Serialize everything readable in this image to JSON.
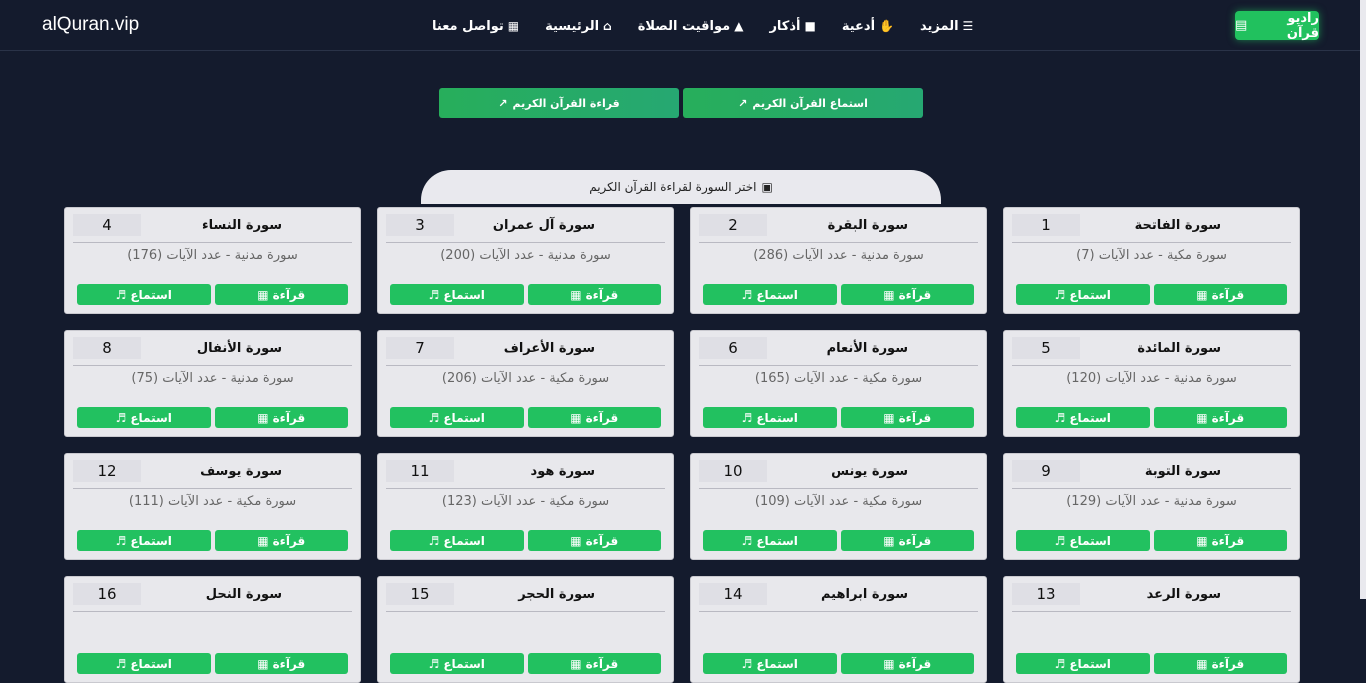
{
  "brand": "alQuran.vip",
  "radio": {
    "label": "راديو قرآن",
    "icon": "radio-icon"
  },
  "nav": [
    {
      "label": "تواصل معنا",
      "icon": "contact-icon"
    },
    {
      "label": "الرئيسية",
      "icon": "home-icon"
    },
    {
      "label": "مواقيت الصلاة",
      "icon": "mosque-icon"
    },
    {
      "label": "أذكار",
      "icon": "book-icon"
    },
    {
      "label": "أدعية",
      "icon": "praying-hands-icon"
    },
    {
      "label": "المزيد",
      "icon": "menu-icon"
    }
  ],
  "top_buttons": {
    "listen": "استماع القرآن الكريم",
    "read": "قراءة القرآن الكريم"
  },
  "section_title": "اختر السورة لقراءة القرآن الكريم",
  "buttons": {
    "read": "قرآءة",
    "listen": "استماع"
  },
  "surahs": [
    {
      "num": "1",
      "name": "سورة الفاتحة",
      "info": "سورة مكية - عدد الآيات (7)"
    },
    {
      "num": "2",
      "name": "سورة البقرة",
      "info": "سورة مدنية - عدد الآيات (286)"
    },
    {
      "num": "3",
      "name": "سورة آل عمران",
      "info": "سورة مدنية - عدد الآيات (200)"
    },
    {
      "num": "4",
      "name": "سورة النساء",
      "info": "سورة مدنية - عدد الآيات (176)"
    },
    {
      "num": "5",
      "name": "سورة المائدة",
      "info": "سورة مدنية - عدد الآيات (120)"
    },
    {
      "num": "6",
      "name": "سورة الأنعام",
      "info": "سورة مكية - عدد الآيات (165)"
    },
    {
      "num": "7",
      "name": "سورة الأعراف",
      "info": "سورة مكية - عدد الآيات (206)"
    },
    {
      "num": "8",
      "name": "سورة الأنفال",
      "info": "سورة مدنية - عدد الآيات (75)"
    },
    {
      "num": "9",
      "name": "سورة التوبة",
      "info": "سورة مدنية - عدد الآيات (129)"
    },
    {
      "num": "10",
      "name": "سورة يونس",
      "info": "سورة مكية - عدد الآيات (109)"
    },
    {
      "num": "11",
      "name": "سورة هود",
      "info": "سورة مكية - عدد الآيات (123)"
    },
    {
      "num": "12",
      "name": "سورة يوسف",
      "info": "سورة مكية - عدد الآيات (111)"
    },
    {
      "num": "13",
      "name": "سورة الرعد",
      "info": ""
    },
    {
      "num": "14",
      "name": "سورة ابراهيم",
      "info": ""
    },
    {
      "num": "15",
      "name": "سورة الحجر",
      "info": ""
    },
    {
      "num": "16",
      "name": "سورة النحل",
      "info": ""
    }
  ]
}
